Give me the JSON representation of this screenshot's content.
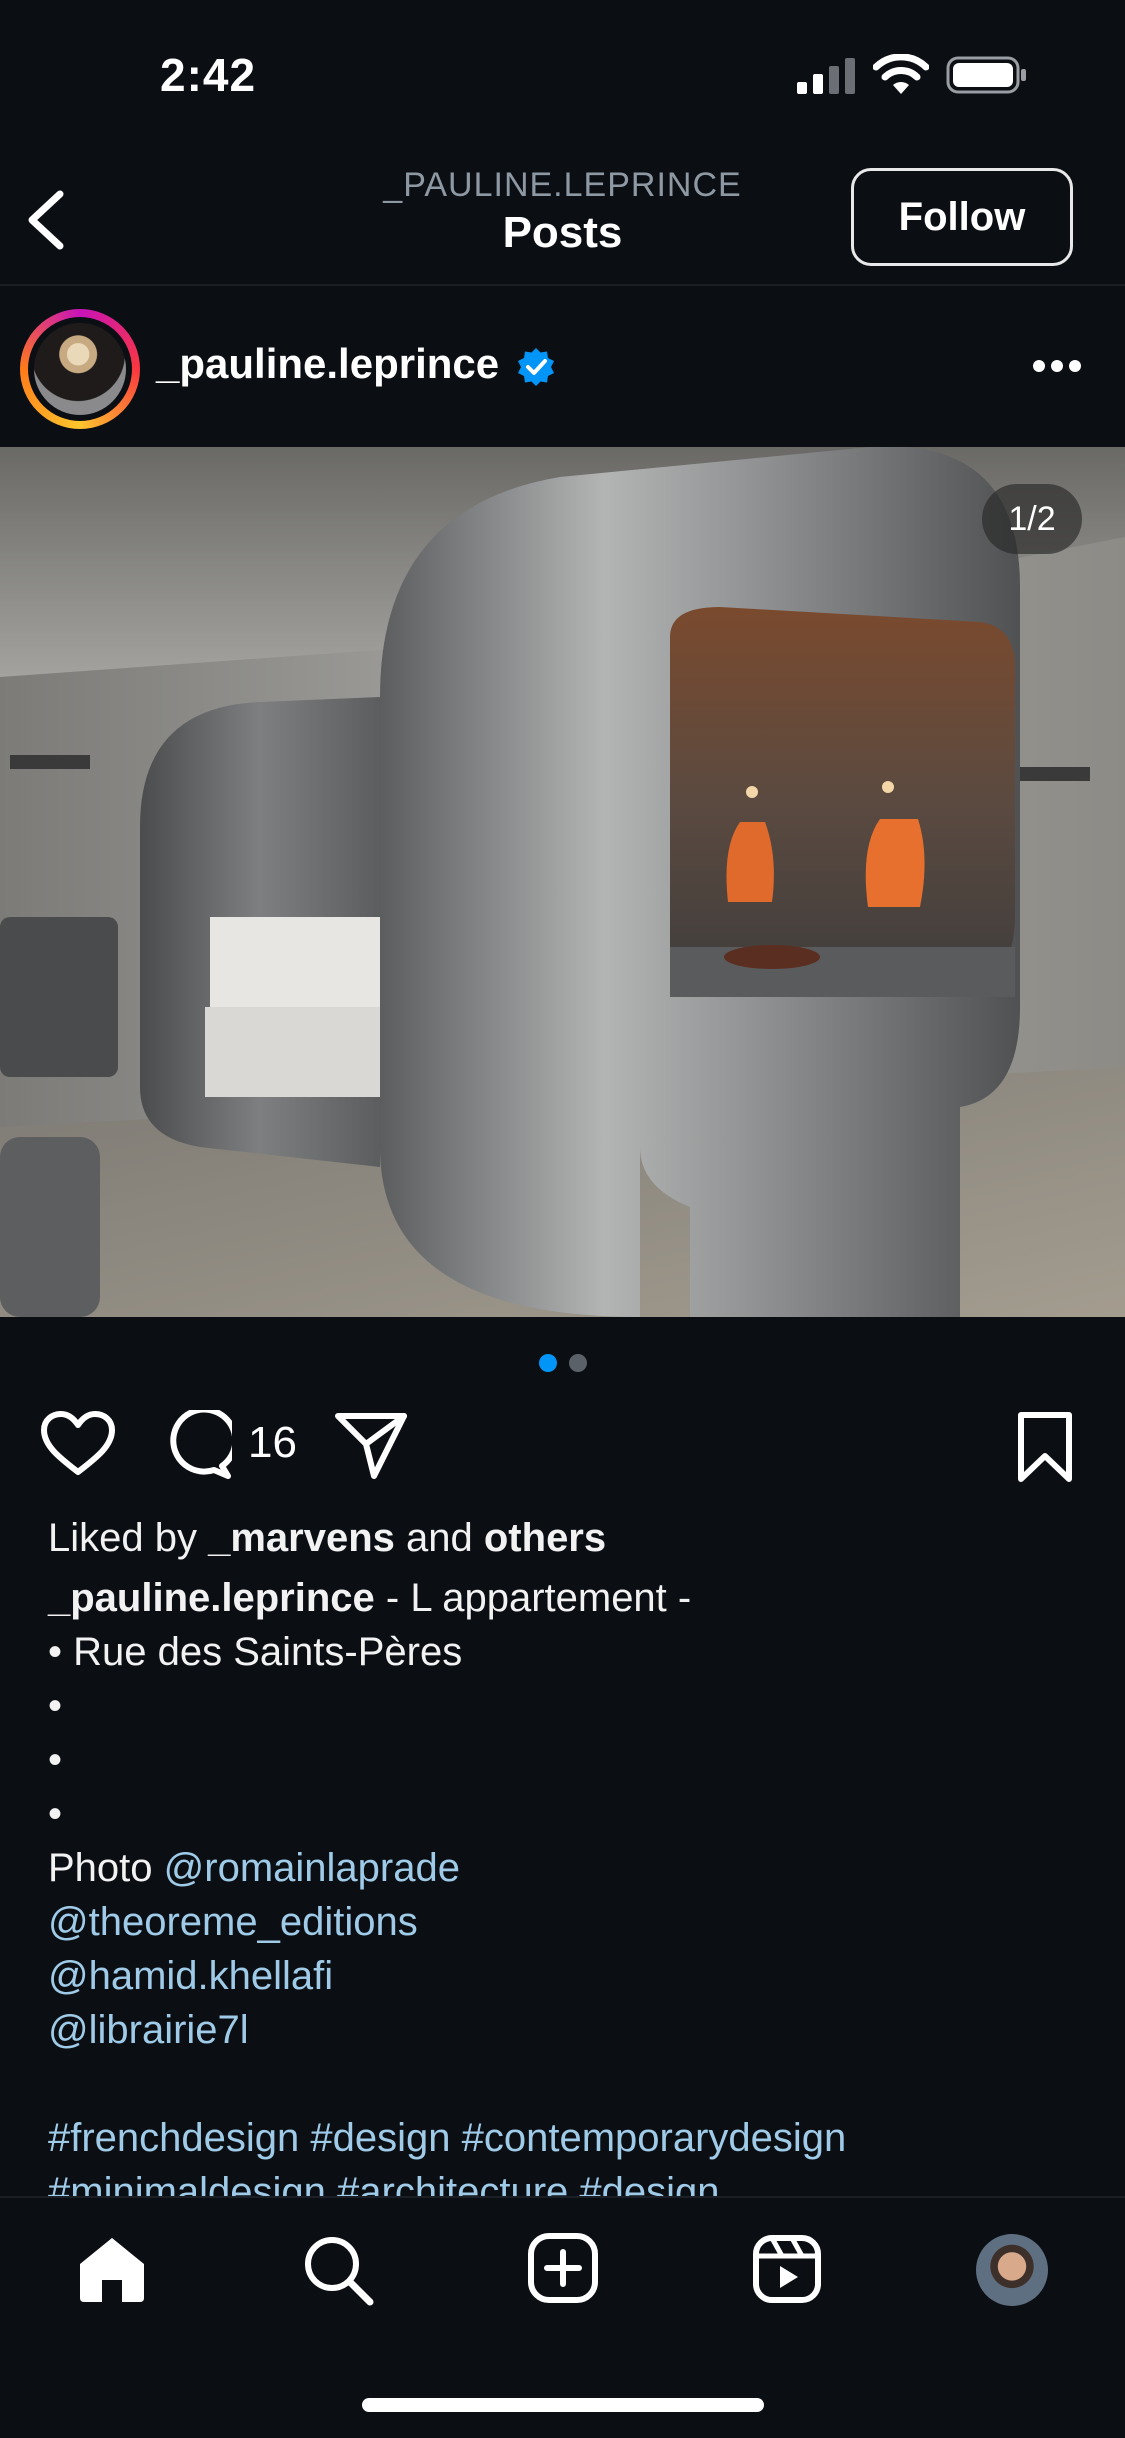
{
  "status_bar": {
    "time": "2:42"
  },
  "header": {
    "username": "_PAULINE.LEPRINCE",
    "title": "Posts",
    "follow_label": "Follow"
  },
  "post": {
    "username": "_pauline.leprince",
    "image_counter": "1/2",
    "carousel_active": 1,
    "carousel_total": 2,
    "comment_count": "16",
    "liked_by_prefix": "Liked by ",
    "liked_by_user": "_marvens",
    "liked_by_mid": " and ",
    "liked_by_others": "others",
    "caption_user": "_pauline.leprince",
    "caption_text": " - L appartement -",
    "caption_lines": [
      "• Rue des Saints-Pères",
      "•",
      "•",
      "•"
    ],
    "photo_prefix": "Photo ",
    "mentions": [
      "@romainlaprade",
      "@theoreme_editions",
      "@hamid.khellafi",
      "@librairie7l"
    ],
    "hashtags_line1": "#frenchdesign #design #contemporarydesign",
    "hashtags_line2": "#minimaldesign #architecture #design"
  },
  "nav": [
    "home-icon",
    "search-icon",
    "add-icon",
    "reels-icon",
    "profile-avatar"
  ],
  "colors": {
    "accent": "#0095f6",
    "link": "#9fcbe8",
    "background": "#0b0f14"
  }
}
